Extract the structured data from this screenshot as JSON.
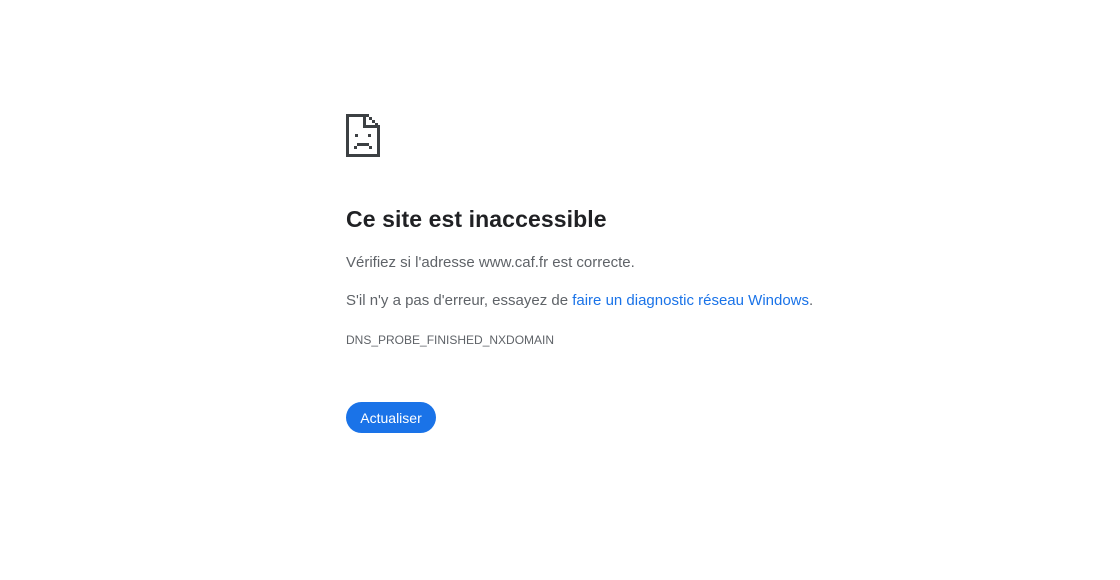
{
  "error": {
    "icon": "sad-page-icon",
    "title": "Ce site est inaccessible",
    "check_address": "Vérifiez si l'adresse www.caf.fr est correcte.",
    "suggestion_prefix": "S'il n'y a pas d'erreur, essayez de ",
    "suggestion_link": "faire un diagnostic réseau Windows",
    "suggestion_suffix": ".",
    "code": "DNS_PROBE_FINISHED_NXDOMAIN",
    "reload_label": "Actualiser"
  },
  "colors": {
    "accent": "#1a73e8",
    "title_text": "#202124",
    "body_text": "#5f6368",
    "icon": "#3c4043"
  }
}
